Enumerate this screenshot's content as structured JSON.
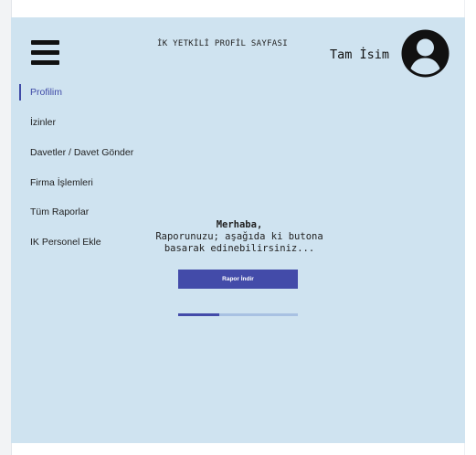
{
  "header": {
    "page_title": "İK YETKİLİ PROFİL SAYFASI",
    "user_name": "Tam İsim"
  },
  "sidebar": {
    "items": [
      {
        "label": "Profilim",
        "active": true
      },
      {
        "label": "İzinler",
        "active": false
      },
      {
        "label": "Davetler / Davet Gönder",
        "active": false
      },
      {
        "label": "Firma İşlemleri",
        "active": false
      },
      {
        "label": "Tüm Raporlar",
        "active": false
      },
      {
        "label": "IK Personel Ekle",
        "active": false
      }
    ]
  },
  "main": {
    "greeting": "Merhaba,",
    "message_line1": "Raporunuzu; aşağıda ki butona",
    "message_line2": "basarak edinebilirsiniz...",
    "download_button_label": "Rapor İndir",
    "progress_fraction": 0.34
  },
  "icons": {
    "menu": "hamburger-menu-icon",
    "avatar": "user-avatar-icon"
  },
  "colors": {
    "background": "#cfe3f0",
    "accent": "#434ba9",
    "progress_track": "#a8c1e2"
  }
}
